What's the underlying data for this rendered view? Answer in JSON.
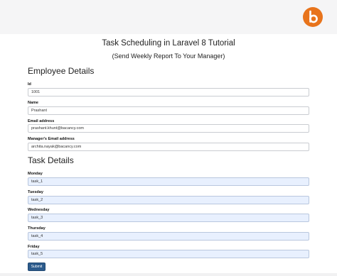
{
  "header": {
    "title": "Task Scheduling in Laravel 8 Tutorial",
    "subtitle": "(Send Weekly Report To Your Manager)",
    "brand_color": "#e8741c",
    "logo_icon": "bacancy-logo-icon"
  },
  "employee": {
    "heading": "Employee Details",
    "id_label": "Id",
    "id_value": "1001",
    "name_label": "Name",
    "name_value": "Prashant",
    "email_label": "Email address",
    "email_value": "prashant.khunt@bacancy.com",
    "manager_email_label": "Manager's Email address",
    "manager_email_value": "archita.nayak@bacancy.com"
  },
  "tasks": {
    "heading": "Task Details",
    "monday_label": "Monday",
    "monday_value": "task_1",
    "tuesday_label": "Tuesday",
    "tuesday_value": "task_2",
    "wednesday_label": "Wednesday",
    "wednesday_value": "task_3",
    "thursday_label": "Thursday",
    "thursday_value": "task_4",
    "friday_label": "Friday",
    "friday_value": "task_5"
  },
  "form": {
    "submit_label": "Submit",
    "submit_color": "#2c5b8c"
  }
}
